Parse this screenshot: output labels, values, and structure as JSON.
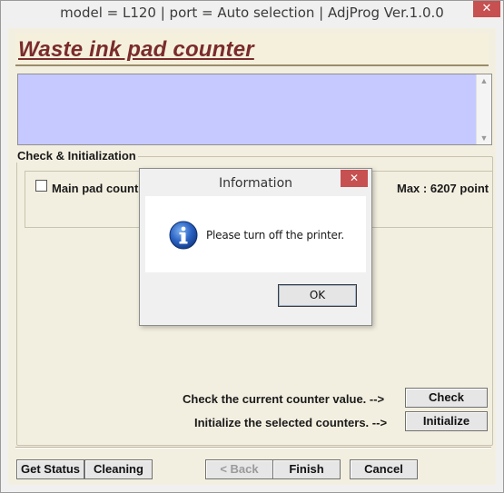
{
  "window": {
    "title": "model = L120 | port = Auto selection | AdjProg Ver.1.0.0",
    "close_glyph": "✕"
  },
  "header": {
    "title": "Waste ink pad counter"
  },
  "group": {
    "title": "Check & Initialization",
    "main_pad_label": "Main pad count",
    "max_label": "Max : 6207 point"
  },
  "actions": {
    "check_text": "Check the current counter value.  -->",
    "check_button": "Check",
    "init_text": "Initialize the selected counters.  -->",
    "init_button": "Initialize"
  },
  "footer": {
    "get_status": "Get Status",
    "cleaning": "Cleaning",
    "back": "< Back",
    "finish": "Finish",
    "cancel": "Cancel"
  },
  "dialog": {
    "title": "Information",
    "message": "Please turn off the printer.",
    "ok": "OK",
    "icon": "info-icon"
  },
  "colors": {
    "heading": "#7a2b2b",
    "message_area": "#c6c9ff",
    "close_button": "#c75050",
    "client_bg": "#f3efe0"
  }
}
